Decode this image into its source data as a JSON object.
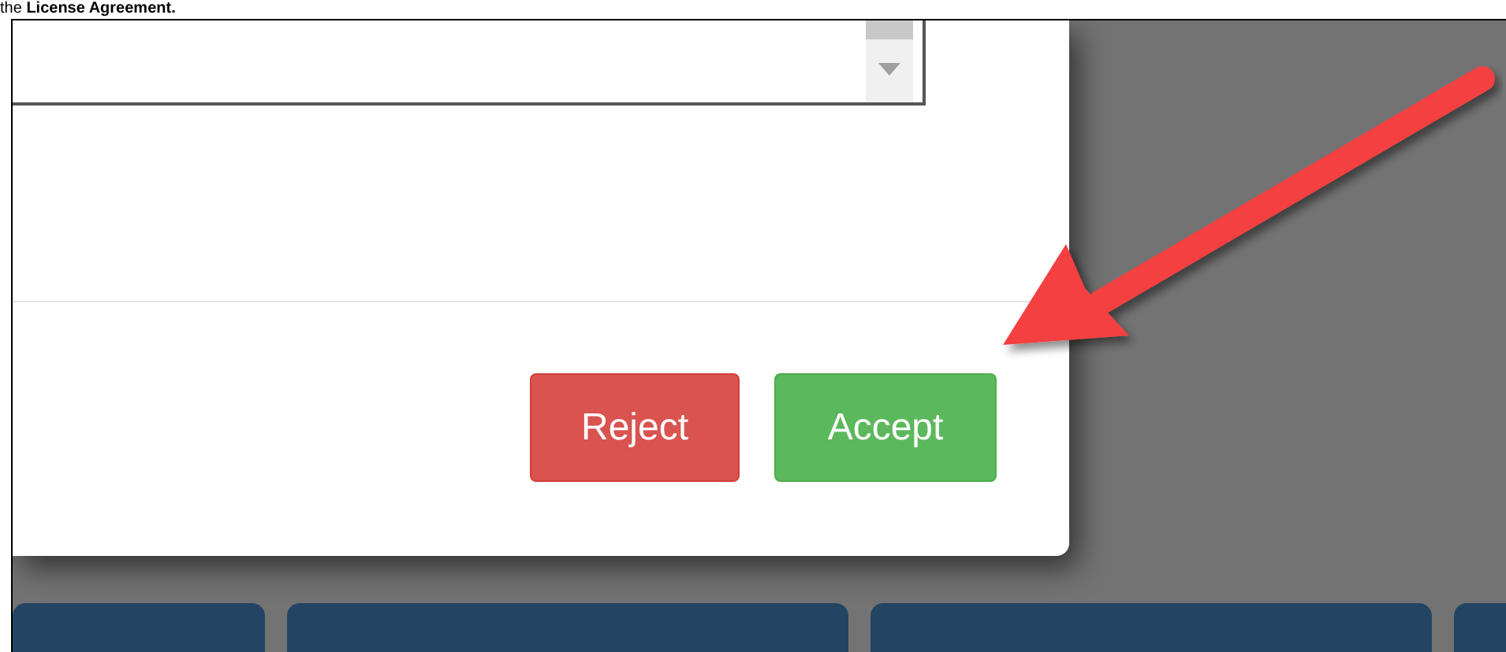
{
  "caption": "the **License Agreement.**",
  "dialog": {
    "buttons": [
      {
        "label": "Reject",
        "kind": "danger"
      },
      {
        "label": "Accept",
        "kind": "success"
      }
    ]
  }
}
